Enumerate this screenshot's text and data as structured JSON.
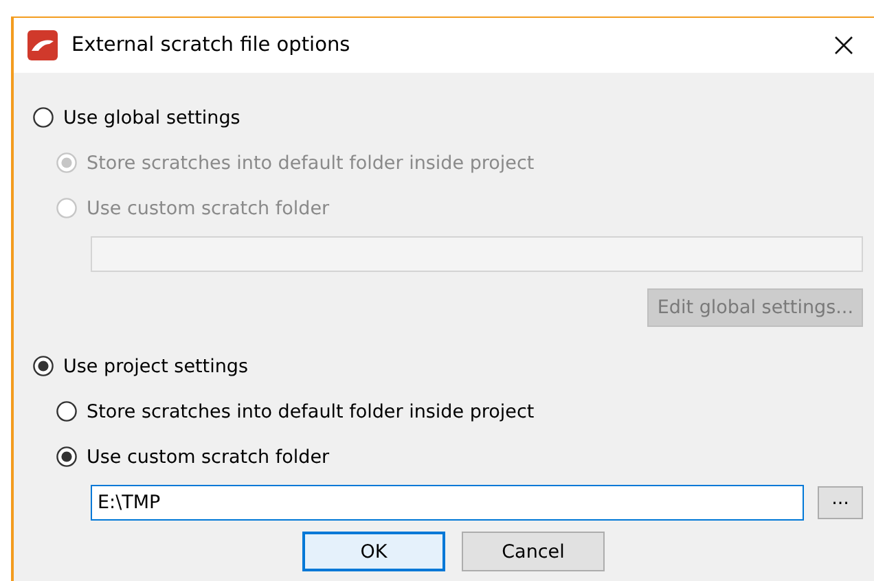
{
  "window": {
    "title": "External scratch file options"
  },
  "groups": [
    {
      "label": "Use global settings",
      "selected": false,
      "options": [
        {
          "label": "Store scratches into default folder inside project",
          "selected": true,
          "disabled": true
        },
        {
          "label": "Use custom scratch folder",
          "selected": false,
          "disabled": true
        }
      ],
      "field": {
        "disabled": true
      },
      "action": {
        "label": "Edit global settings...",
        "disabled": true
      }
    },
    {
      "label": "Use project settings",
      "selected": true,
      "options": [
        {
          "label": "Store scratches into default folder inside project",
          "selected": false,
          "disabled": false
        },
        {
          "label": "Use custom scratch folder",
          "selected": true,
          "disabled": false
        }
      ],
      "field": {
        "value": "E:\\TMP",
        "disabled": false,
        "focused": true,
        "browse": "..."
      }
    }
  ],
  "buttons": [
    {
      "label": "OK",
      "default": true
    },
    {
      "label": "Cancel",
      "default": false
    }
  ]
}
